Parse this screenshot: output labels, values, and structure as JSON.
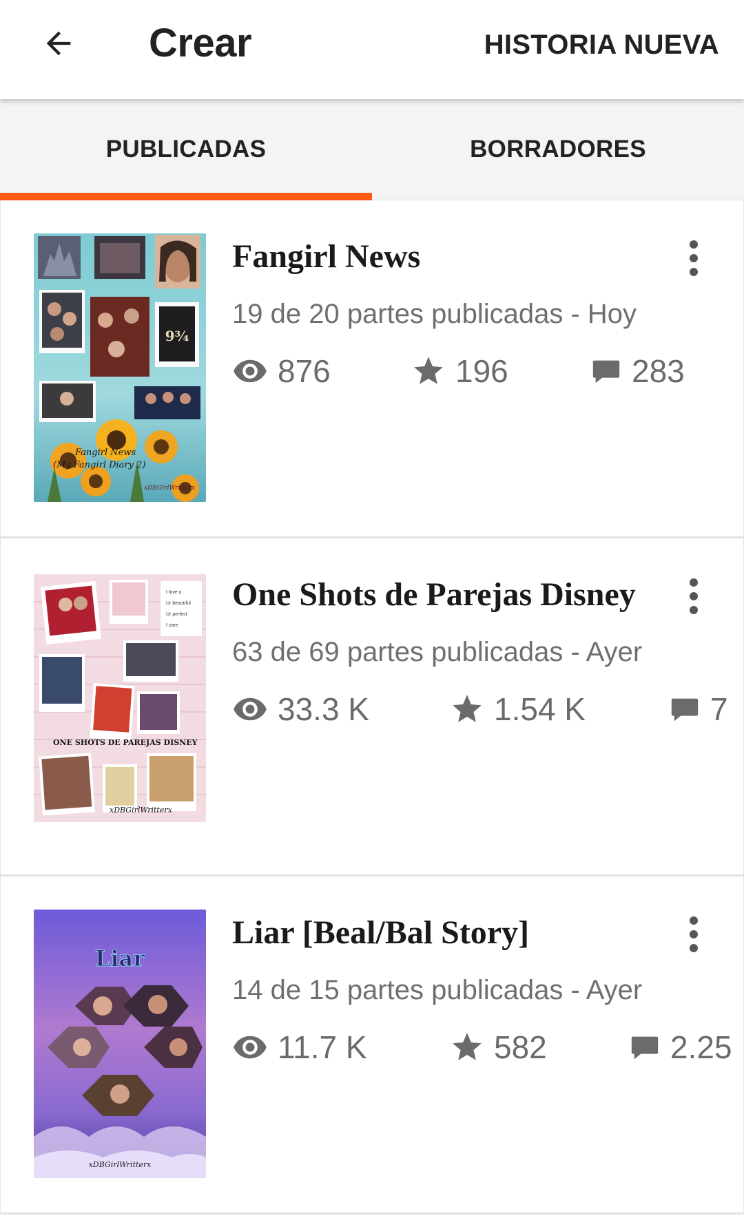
{
  "appbar": {
    "back_icon": "arrow-left-icon",
    "title": "Crear",
    "new_story_label": "HISTORIA NUEVA"
  },
  "tabs": [
    {
      "label": "PUBLICADAS",
      "selected": true
    },
    {
      "label": "BORRADORES",
      "selected": false
    }
  ],
  "accent_color": "#ff5a0f",
  "stories": [
    {
      "title": "Fangirl News",
      "meta": "19 de 20 partes publicadas - Hoy",
      "reads": "876",
      "votes": "196",
      "comments": "283",
      "cover_text": "Fangirl News (My Fangirl Diary 2)"
    },
    {
      "title": "One Shots de Parejas Disney",
      "meta": "63 de 69 partes publicadas - Ayer",
      "reads": "33.3 K",
      "votes": "1.54 K",
      "comments": "7",
      "cover_text": "ONE SHOTS DE PAREJAS DISNEY"
    },
    {
      "title": "Liar [Beal/Bal Story]",
      "meta": "14 de 15 partes publicadas - Ayer",
      "reads": "11.7 K",
      "votes": "582",
      "comments": "2.25",
      "cover_text": "Liar"
    }
  ],
  "icons": {
    "reads": "eye-icon",
    "votes": "star-icon",
    "comments": "comment-icon",
    "more": "more-vertical-icon"
  }
}
